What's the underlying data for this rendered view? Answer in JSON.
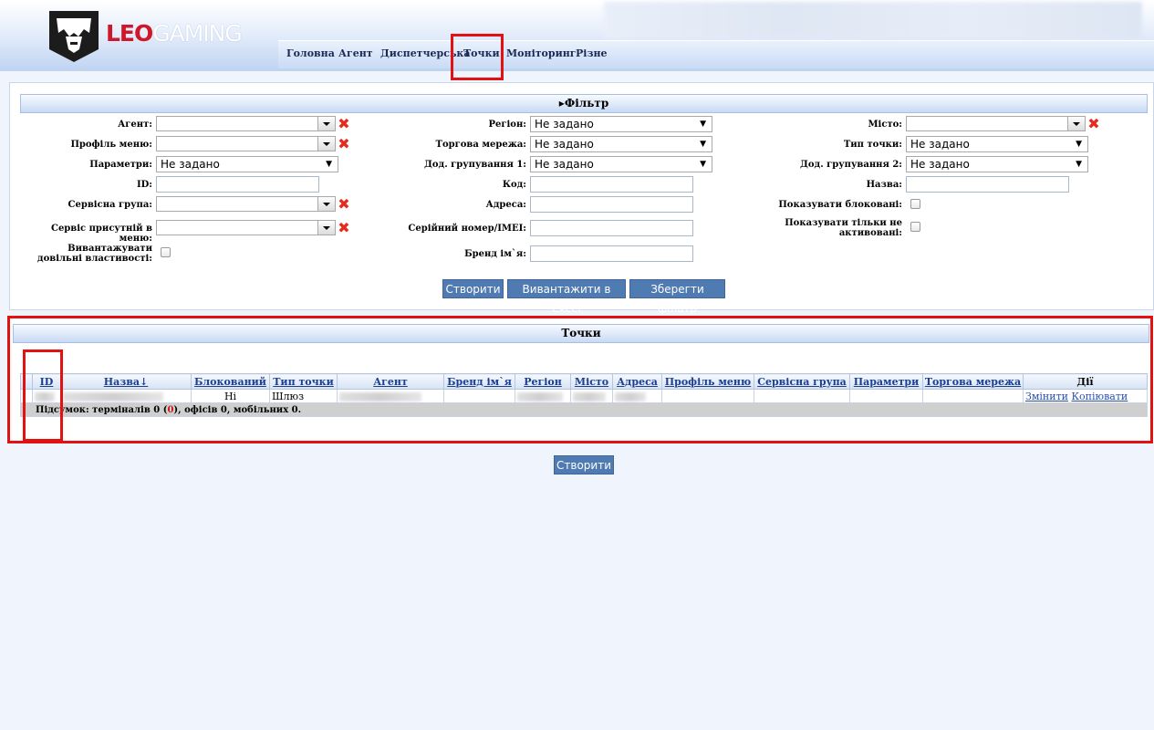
{
  "brand": {
    "leo": "LEO",
    "gaming": "GAMING"
  },
  "nav": [
    "Головна",
    "Агент",
    "Диспетчерська",
    "Точки",
    "Моніторинг",
    "Різне"
  ],
  "filter": {
    "title": "Фільтр",
    "labels": {
      "agent": "Агент:",
      "menu_profile": "Профіль меню:",
      "params": "Параметри:",
      "id": "ID:",
      "service_group": "Сервісна група:",
      "service_in_menu": "Сервіс присутній в меню:",
      "export_props": "Вивантажувати довільні властивості:",
      "region": "Регіон:",
      "trade_network": "Торгова мережа:",
      "group1": "Дод. групування 1:",
      "code": "Код:",
      "address": "Адреса:",
      "serial": "Серійний номер/IMEI:",
      "brand_name": "Бренд ім`я:",
      "city": "Місто:",
      "point_type": "Тип точки:",
      "group2": "Дод. групування 2:",
      "name": "Назва:",
      "show_blocked": "Показувати блоковані:",
      "show_inactive": "Показувати тільки не активовані:"
    },
    "not_set": "Не задано",
    "buttons": {
      "create": "Створити",
      "export_excel": "Вивантажити в Excel",
      "save_filter": "Зберегти фільтр"
    }
  },
  "points": {
    "title": "Точки",
    "columns": [
      "ID",
      "Назва↓",
      "Блокований",
      "Тип точки",
      "Агент",
      "Бренд ім`я",
      "Регіон",
      "Місто",
      "Адреса",
      "Профіль меню",
      "Сервісна група",
      "Параметри",
      "Торгова мережа",
      "Дії"
    ],
    "row": {
      "blocked": "Ні",
      "type": "Шлюз",
      "edit": "Змінити",
      "copy": "Копіювати"
    },
    "summary_a": "Підсумок: терміналів 0 (",
    "summary_red": "0",
    "summary_b": "), офісів 0, мобільних 0."
  },
  "bottom_button": "Створити",
  "colors": {
    "accent_button": "#4f7ab2",
    "highlight": "#e31212",
    "brand_red": "#d0162a"
  }
}
